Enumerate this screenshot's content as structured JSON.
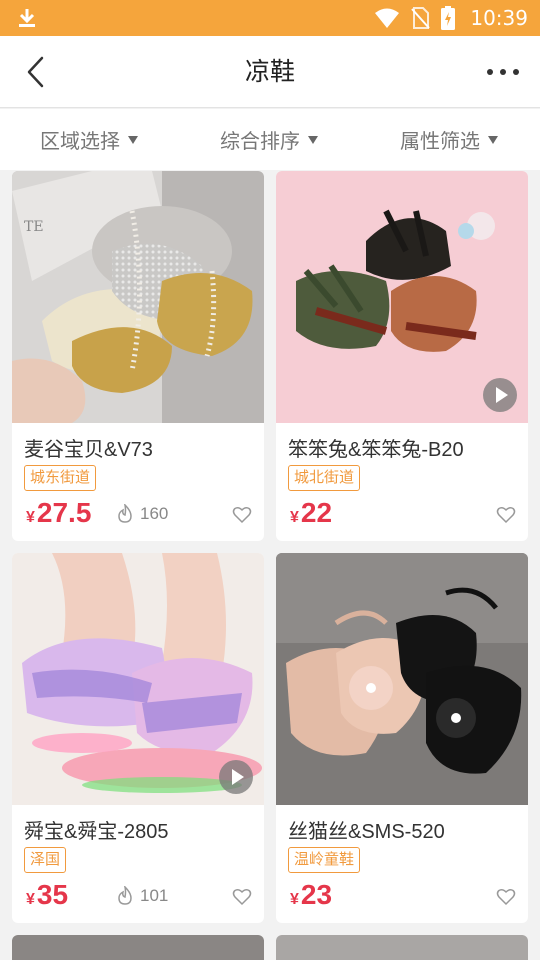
{
  "status_bar": {
    "time": "10:39"
  },
  "header": {
    "title": "凉鞋"
  },
  "filters": [
    {
      "label": "区域选择"
    },
    {
      "label": "综合排序"
    },
    {
      "label": "属性筛选"
    }
  ],
  "products": [
    {
      "name": "麦谷宝贝&V73",
      "tag": "城东街道",
      "currency": "¥",
      "price": "27.5",
      "popularity": "160",
      "has_video": false
    },
    {
      "name": "笨笨兔&笨笨兔-B20",
      "tag": "城北街道",
      "currency": "¥",
      "price": "22",
      "popularity": "",
      "has_video": true
    },
    {
      "name": "舜宝&舜宝-2805",
      "tag": "泽国",
      "currency": "¥",
      "price": "35",
      "popularity": "101",
      "has_video": true
    },
    {
      "name": "丝猫丝&SMS-520",
      "tag": "温岭童鞋",
      "currency": "¥",
      "price": "23",
      "popularity": "",
      "has_video": false
    }
  ],
  "colors": {
    "status_bar": "#f5a53c",
    "price": "#e5364a",
    "tag": "#f19a3e"
  }
}
